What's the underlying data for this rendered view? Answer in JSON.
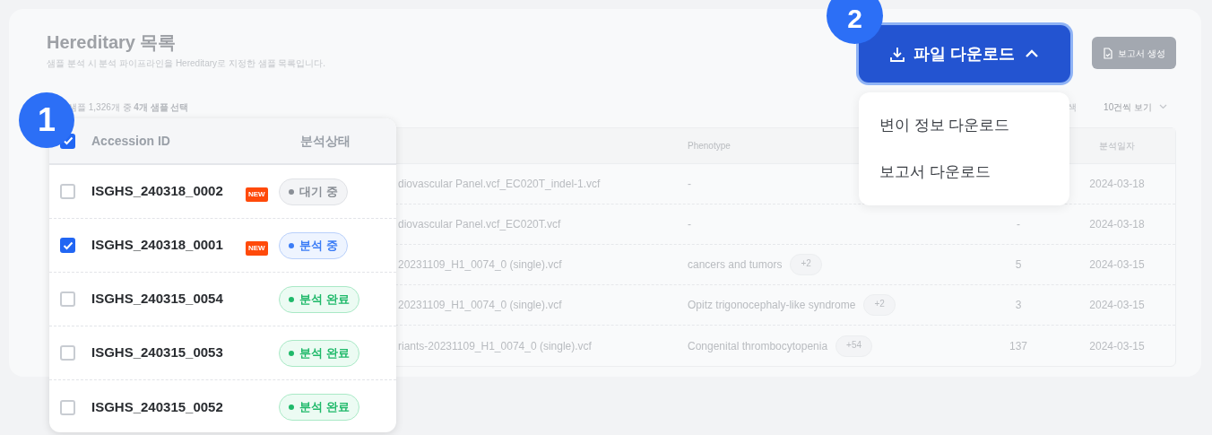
{
  "page": {
    "title": "Hereditary 목록",
    "subtitle": "샘플 분석 시 분석 파이프라인을 Hereditary로 지정한 샘플 목록입니다.",
    "selection_text": "샘플 1,326개 중 **4개 샘플 선택**",
    "search_fragment": "색",
    "page_size": "10건씩 보기"
  },
  "download_button": {
    "label": "파일 다운로드",
    "expanded": true
  },
  "report_button": {
    "label": "보고서 생성",
    "disabled": true
  },
  "download_menu": [
    {
      "label": "변이 정보 다운로드"
    },
    {
      "label": "보고서 다운로드"
    }
  ],
  "callouts": [
    {
      "number": "1"
    },
    {
      "number": "2"
    }
  ],
  "background_table": {
    "columns": [
      "Phenotype",
      "분석일자"
    ],
    "rows": [
      {
        "file": "diovascular Panel.vcf_EC020T_indel-1.vcf",
        "phenotype": {
          "label": "-"
        },
        "date": "2024-03-18"
      },
      {
        "file": "diovascular Panel.vcf_EC020T.vcf",
        "phenotype": {
          "label": "-"
        },
        "count": "-",
        "date": "2024-03-18"
      },
      {
        "file": "20231109_H1_0074_0 (single).vcf",
        "phenotype": {
          "label": "cancers and tumors",
          "more": "+2"
        },
        "count": "5",
        "date": "2024-03-15"
      },
      {
        "file": "20231109_H1_0074_0 (single).vcf",
        "phenotype": {
          "label": "Opitz trigonocephaly-like syndrome",
          "more": "+2"
        },
        "count": "3",
        "date": "2024-03-15"
      },
      {
        "file": "riants-20231109_H1_0074_0 (single).vcf",
        "phenotype": {
          "label": "Congenital thrombocytopenia",
          "more": "+54"
        },
        "count": "137",
        "date": "2024-03-15"
      }
    ]
  },
  "sample_panel": {
    "header_checked": true,
    "columns": [
      "Accession ID",
      "분석상태"
    ],
    "rows": [
      {
        "id": "ISGHS_240318_0002",
        "checked": false,
        "badge": "NEW",
        "status": "대기 중",
        "kind": "waiting"
      },
      {
        "id": "ISGHS_240318_0001",
        "checked": true,
        "badge": "NEW",
        "status": "분석 중",
        "kind": "running"
      },
      {
        "id": "ISGHS_240315_0054",
        "checked": false,
        "status": "분석 완료",
        "kind": "done"
      },
      {
        "id": "ISGHS_240315_0053",
        "checked": false,
        "status": "분석 완료",
        "kind": "done"
      },
      {
        "id": "ISGHS_240315_0052",
        "checked": false,
        "status": "분석 완료",
        "kind": "done"
      }
    ]
  }
}
